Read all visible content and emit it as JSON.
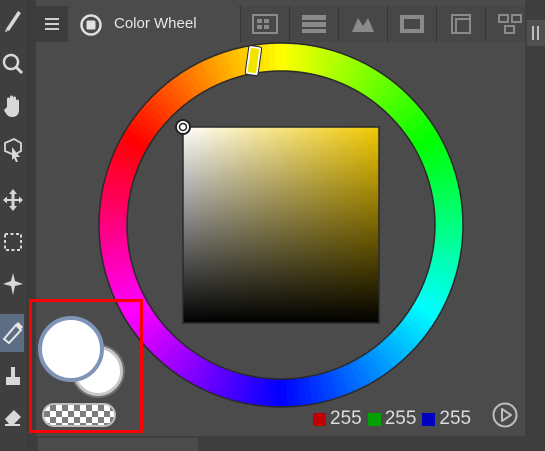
{
  "panel": {
    "tab_title": "Color Wheel",
    "tab_icons": [
      "color-set-icon",
      "intermediate-color-icon",
      "approximate-color-icon",
      "history-icon",
      "layer-property-icon",
      "navigator-icon"
    ]
  },
  "tools": [
    "pen-icon",
    "zoom-icon",
    "hand-icon",
    "operation-icon",
    "move-layer-icon",
    "selection-icon",
    "auto-select-icon",
    "eyedropper-icon",
    "fill-icon",
    "eraser-icon"
  ],
  "color": {
    "main": "#ffffff",
    "sub": "#ffffff",
    "hue_indicator": "yellow"
  },
  "rgb": {
    "r": "255",
    "g": "255",
    "b": "255",
    "r_color": "#c00000",
    "g_color": "#00a000",
    "b_color": "#0000c0"
  },
  "highlight_color": "#ff0000"
}
